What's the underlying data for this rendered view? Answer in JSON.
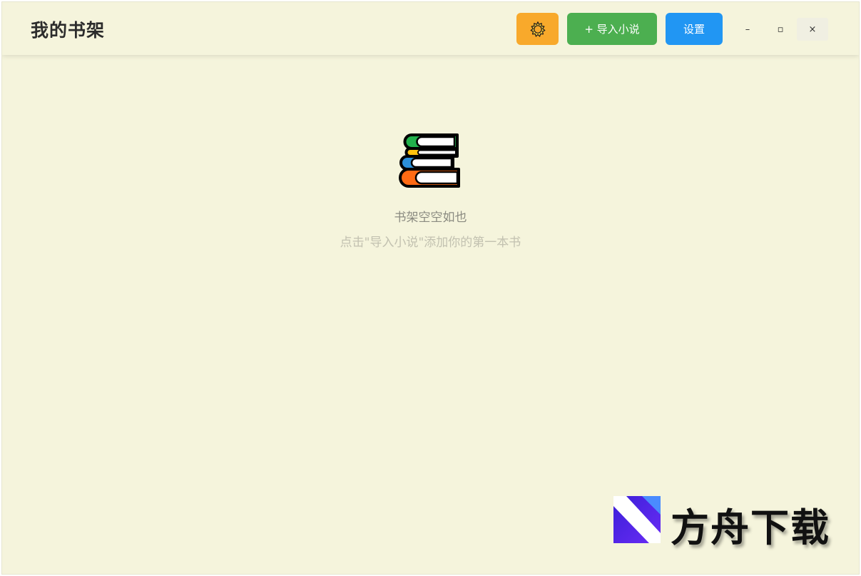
{
  "app": {
    "title": "我的书架"
  },
  "toolbar": {
    "theme_icon": "sun-icon",
    "import_label": "+ 导入小说",
    "settings_label": "设置"
  },
  "window_controls": {
    "minimize": "–",
    "maximize": "▫",
    "close": "×"
  },
  "empty_state": {
    "icon": "books-stack-icon",
    "title": "书架空空如也",
    "hint": "点击\"导入小说\"添加你的第一本书"
  },
  "watermark": {
    "text": "方舟下载"
  },
  "colors": {
    "background": "#f5f4dc",
    "theme_button": "#f8a92b",
    "import_button": "#4caf50",
    "settings_button": "#2196f3"
  }
}
